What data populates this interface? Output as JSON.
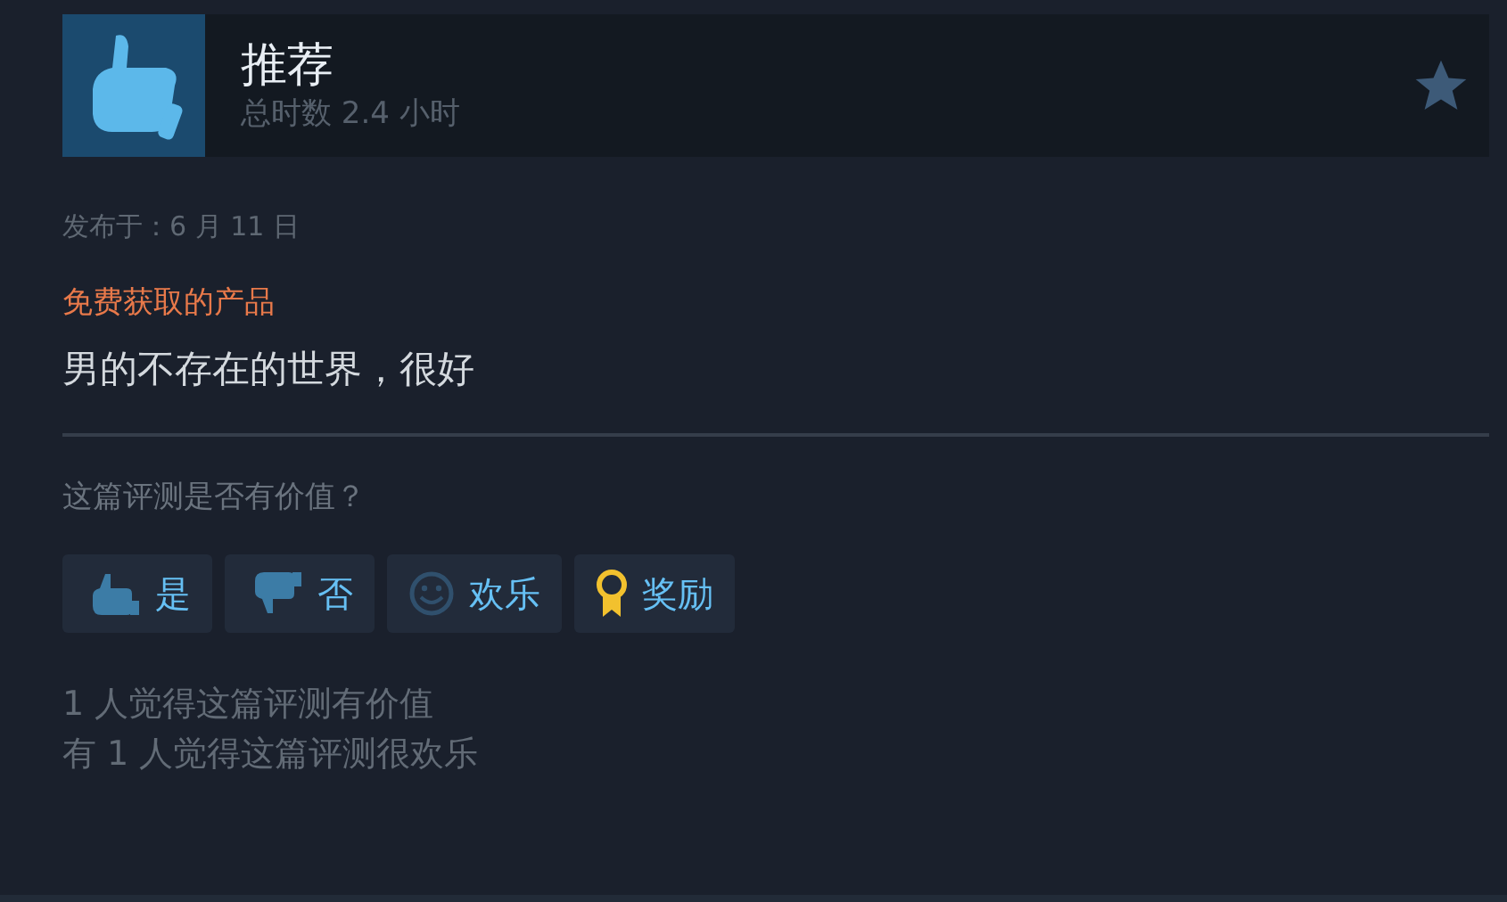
{
  "review": {
    "verdict": "推荐",
    "hours": "总时数 2.4 小时",
    "posted": "发布于：6 月 11 日",
    "free_label": "免费获取的产品",
    "text": "男的不存在的世界，很好"
  },
  "helpful": {
    "question": "这篇评测是否有价值？",
    "buttons": [
      {
        "kind": "up",
        "label": "是"
      },
      {
        "kind": "down",
        "label": "否"
      },
      {
        "kind": "smile",
        "label": "欢乐"
      },
      {
        "kind": "award",
        "label": "奖励"
      }
    ],
    "stats": [
      "1 人觉得这篇评测有价值",
      "有 1 人觉得这篇评测很欢乐"
    ]
  }
}
